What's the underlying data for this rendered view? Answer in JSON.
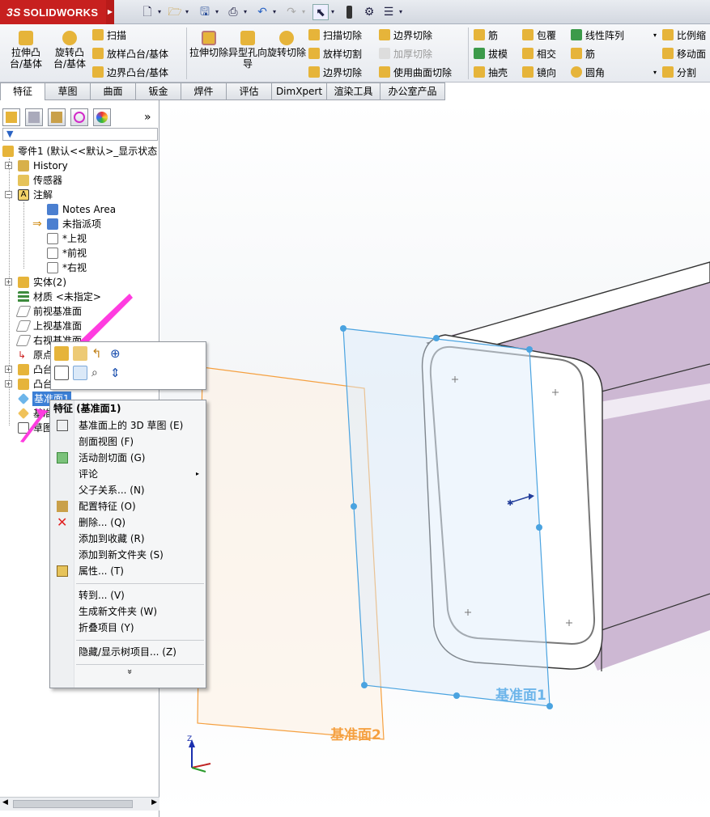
{
  "app": {
    "name": "SOLIDWORKS",
    "ds_mark": "3S"
  },
  "ribbon": {
    "big": [
      {
        "label": "拉伸凸台/基体"
      },
      {
        "label": "旋转凸台/基体"
      },
      {
        "label": "拉伸切除"
      },
      {
        "label": "异型孔向导"
      },
      {
        "label": "旋转切除"
      }
    ],
    "col1": [
      "扫描",
      "放样凸台/基体",
      "边界凸台/基体"
    ],
    "col2": [
      "扫描切除",
      "放样切割",
      "边界切除"
    ],
    "col3": [
      "边界切除",
      "加厚切除",
      "使用曲面切除"
    ],
    "col4": [
      "筋",
      "拔模",
      "抽壳"
    ],
    "col5": [
      "包覆",
      "相交",
      "镜向"
    ],
    "col6": [
      "线性阵列",
      "筋",
      "圆角"
    ],
    "col7": [
      "比例缩",
      "移动面",
      "分割"
    ]
  },
  "tabs": [
    "特征",
    "草图",
    "曲面",
    "钣金",
    "焊件",
    "评估",
    "DimXpert",
    "渲染工具",
    "办公室产品"
  ],
  "panel": {
    "expand": "»"
  },
  "tree": [
    {
      "label": "零件1 (默认<<默认>_显示状态"
    },
    {
      "label": "History"
    },
    {
      "label": "传感器"
    },
    {
      "label": "注解"
    },
    {
      "label": "Notes Area"
    },
    {
      "label": "未指派项"
    },
    {
      "label": "*上视"
    },
    {
      "label": "*前视"
    },
    {
      "label": "*右视"
    },
    {
      "label": "实体(2)"
    },
    {
      "label": "材质 <未指定>"
    },
    {
      "label": "前视基准面"
    },
    {
      "label": "上视基准面"
    },
    {
      "label": "右视基准面"
    },
    {
      "label": "原点"
    },
    {
      "label": "凸台"
    },
    {
      "label": "凸台"
    },
    {
      "label": "基准面1"
    },
    {
      "label": "基准"
    },
    {
      "label": "草图"
    }
  ],
  "context_menu": {
    "header": "特征 (基准面1)",
    "items": [
      "基准面上的 3D 草图 (E)",
      "剖面视图 (F)",
      "活动剖切面 (G)",
      "评论",
      "父子关系... (N)",
      "配置特征 (O)",
      "删除... (Q)",
      "添加到收藏 (R)",
      "添加到新文件夹 (S)",
      "属性... (T)",
      "转到... (V)",
      "生成新文件夹 (W)",
      "折叠项目 (Y)",
      "隐藏/显示树项目... (Z)"
    ],
    "more": "»"
  },
  "viewport": {
    "plane1_label": "基准面1",
    "plane2_label": "基准面2",
    "axis_z": "Z",
    "colors": {
      "plane1": "#4aa3e0",
      "plane2": "#f5a040",
      "body": "#c9b5cf",
      "highlight_arrow": "#ff3ce0"
    }
  }
}
